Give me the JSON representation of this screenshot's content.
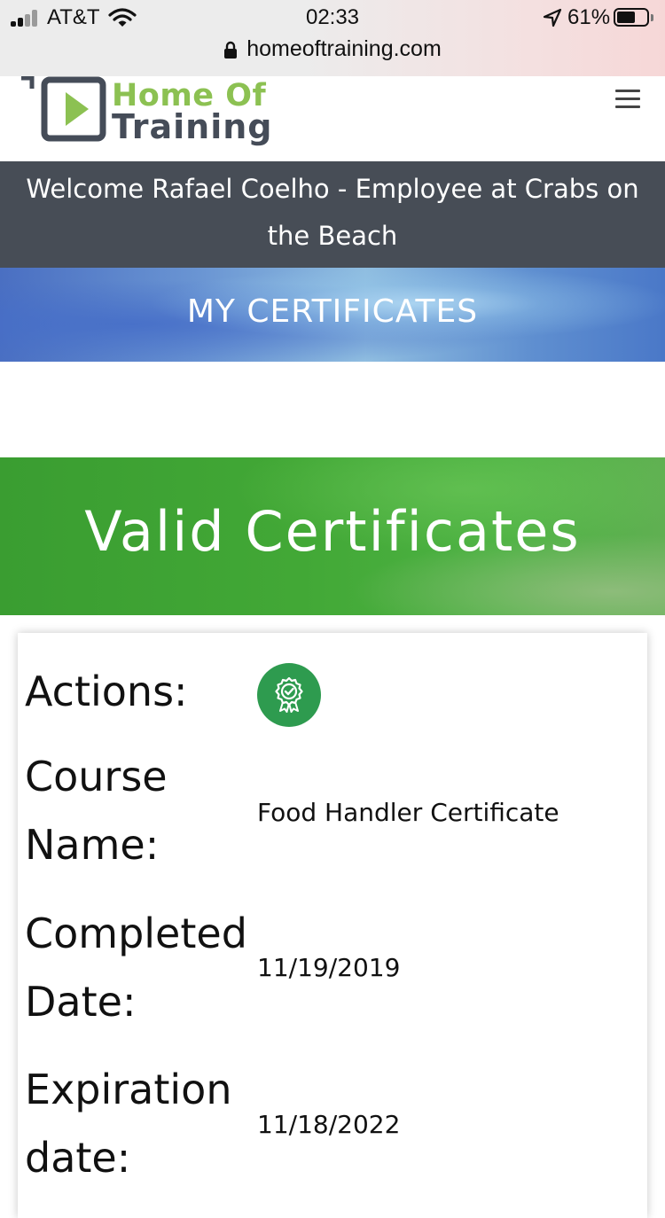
{
  "status_bar": {
    "carrier": "AT&T",
    "time": "02:33",
    "battery_percent": "61%",
    "battery_level": 0.61
  },
  "url_bar": {
    "url": "homeoftraining.com"
  },
  "header": {
    "logo_line1": "Home Of",
    "logo_line2": "Training",
    "logo_accent_color": "#8cc152",
    "logo_dark_color": "#454c58"
  },
  "welcome": {
    "text": "Welcome Rafael Coelho - Employee at Crabs on the Beach"
  },
  "certificates_banner": {
    "title": "MY CERTIFICATES"
  },
  "valid_banner": {
    "title": "Valid Certificates",
    "color": "#42a836"
  },
  "certificate": {
    "actions_label": "Actions:",
    "course_name_label": "Course Name:",
    "course_name": "Food Handler Certificate",
    "completed_label": "Completed Date:",
    "completed_date": "11/19/2019",
    "expiration_label": "Expiration date:",
    "expiration_date": "11/18/2022",
    "action_icon": "certificate-award-icon",
    "action_color": "#2e9b4f"
  }
}
